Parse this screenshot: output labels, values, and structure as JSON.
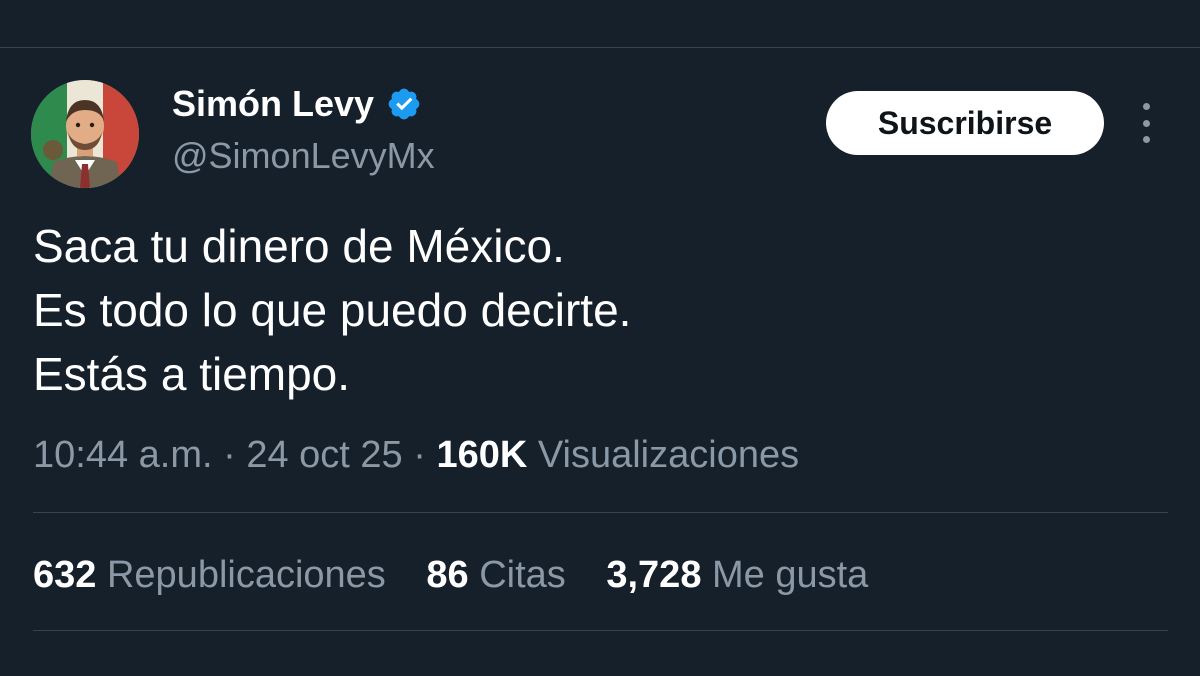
{
  "author": {
    "display_name": "Simón Levy",
    "handle": "@SimonLevyMx",
    "verified": true,
    "avatar_icon": "avatar-illustration"
  },
  "actions": {
    "subscribe_label": "Suscribirse",
    "more_icon": "more-vertical-icon"
  },
  "tweet": {
    "lines": [
      "Saca tu dinero de México.",
      "Es todo lo que puedo decirte.",
      "Estás a tiempo."
    ]
  },
  "meta": {
    "time": "10:44 a.m.",
    "date": "24 oct 25",
    "views_count": "160K",
    "views_label": "Visualizaciones",
    "separator": "·"
  },
  "stats": {
    "reposts_count": "632",
    "reposts_label": "Republicaciones",
    "quotes_count": "86",
    "quotes_label": "Citas",
    "likes_count": "3,728",
    "likes_label": "Me gusta"
  },
  "colors": {
    "background": "#15202b",
    "text_primary": "#ffffff",
    "text_secondary": "#8b98a5",
    "verified_blue": "#1d9bf0",
    "divider": "#38444d"
  }
}
